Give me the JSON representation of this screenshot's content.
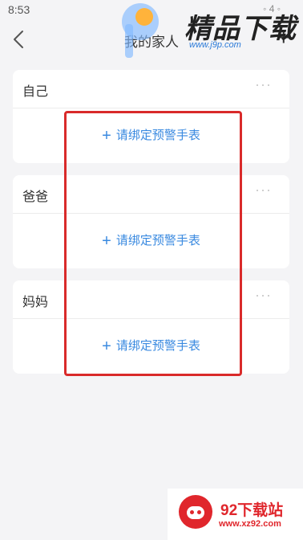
{
  "status_bar": {
    "time": "8:53",
    "signal": "◦ 4 ◦"
  },
  "nav": {
    "title": "我的家人",
    "add_label": "+"
  },
  "members": [
    {
      "name": "自己",
      "bind_label": "请绑定预警手表"
    },
    {
      "name": "爸爸",
      "bind_label": "请绑定预警手表"
    },
    {
      "name": "妈妈",
      "bind_label": "请绑定预警手表"
    }
  ],
  "more_label": "···",
  "plus_label": "+",
  "watermark_top": {
    "brand": "精品下载",
    "url": "www.j9p.com"
  },
  "watermark_bottom": {
    "brand": "92下载站",
    "url": "www.xz92.com"
  },
  "colors": {
    "accent": "#3a8ae0",
    "highlight": "#d92a2a",
    "background": "#f4f4f6"
  },
  "icons": {
    "back": "chevron-left-icon",
    "more": "more-dots-icon",
    "plus": "plus-icon"
  }
}
